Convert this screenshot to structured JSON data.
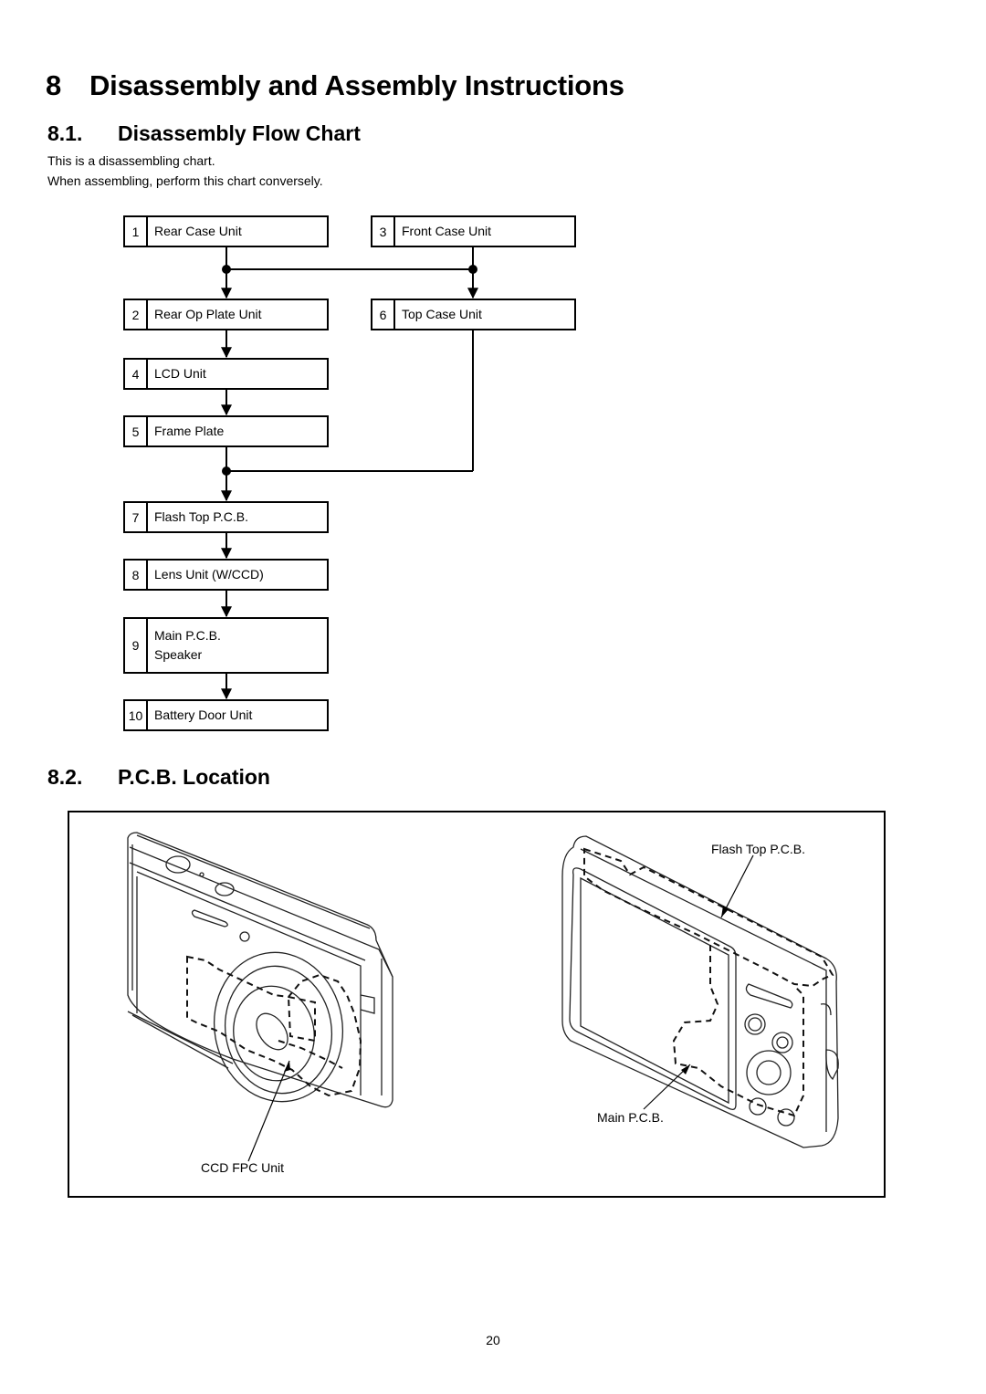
{
  "chapter": {
    "number": "8",
    "title": "Disassembly and Assembly Instructions"
  },
  "section_flow": {
    "number": "8.1.",
    "title": "Disassembly Flow Chart",
    "intro": [
      "This is a disassembling chart.",
      "When assembling, perform this chart conversely."
    ],
    "steps": [
      {
        "num": "1",
        "label": "Rear Case Unit"
      },
      {
        "num": "2",
        "label": "Rear Op Plate Unit"
      },
      {
        "num": "3",
        "label": "Front Case Unit"
      },
      {
        "num": "4",
        "label": "LCD Unit"
      },
      {
        "num": "5",
        "label": "Frame Plate"
      },
      {
        "num": "6",
        "label": "Top Case Unit"
      },
      {
        "num": "7",
        "label": "Flash Top P.C.B."
      },
      {
        "num": "8",
        "label": "Lens Unit (W/CCD)"
      },
      {
        "num": "9",
        "label": "Main P.C.B.",
        "label2": "Speaker"
      },
      {
        "num": "10",
        "label": "Battery Door Unit"
      }
    ],
    "flow": [
      [
        "1+3",
        "2"
      ],
      [
        "1+3",
        "6"
      ],
      [
        "2",
        "4"
      ],
      [
        "4",
        "5"
      ],
      [
        "5+6",
        "7"
      ],
      [
        "7",
        "8"
      ],
      [
        "8",
        "9"
      ],
      [
        "9",
        "10"
      ]
    ]
  },
  "section_pcb": {
    "number": "8.2.",
    "title": "P.C.B. Location",
    "callouts": {
      "front_view": [
        "CCD FPC Unit"
      ],
      "rear_view": [
        "Flash Top P.C.B.",
        "Main P.C.B."
      ]
    }
  },
  "page_number": "20"
}
